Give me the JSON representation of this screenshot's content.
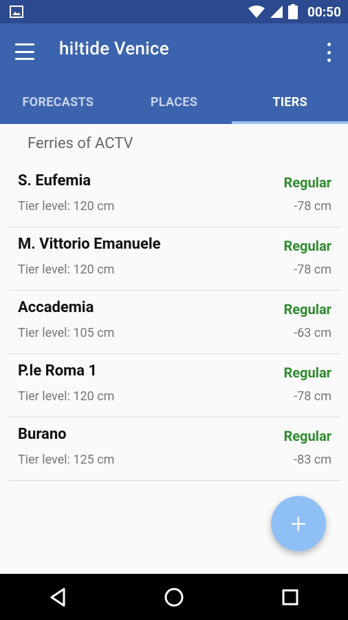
{
  "status_bar": {
    "time": "00:50",
    "icons": [
      "image-icon",
      "wifi-icon",
      "cell-signal-icon",
      "battery-icon"
    ]
  },
  "app_bar": {
    "title": "hi!tide Venice",
    "menu_icon": "hamburger-menu-icon",
    "overflow_icon": "more-vertical-icon"
  },
  "tabs": [
    {
      "label": "FORECASTS",
      "active": false
    },
    {
      "label": "PLACES",
      "active": false
    },
    {
      "label": "TIERS",
      "active": true
    }
  ],
  "section": {
    "title": "Ferries of ACTV"
  },
  "items": [
    {
      "name": "S. Eufemia",
      "status": "Regular",
      "tier": "Tier level: 120 cm",
      "diff": "-78 cm"
    },
    {
      "name": "M. Vittorio Emanuele",
      "status": "Regular",
      "tier": "Tier level: 120 cm",
      "diff": "-78 cm"
    },
    {
      "name": "Accademia",
      "status": "Regular",
      "tier": "Tier level: 105 cm",
      "diff": "-63 cm"
    },
    {
      "name": "P.le Roma 1",
      "status": "Regular",
      "tier": "Tier level: 120 cm",
      "diff": "-78 cm"
    },
    {
      "name": "Burano",
      "status": "Regular",
      "tier": "Tier level: 125 cm",
      "diff": "-83 cm"
    }
  ],
  "fab": {
    "icon": "plus-icon",
    "glyph": "+"
  },
  "colors": {
    "status_bar": "#2b4a8f",
    "app_bar": "#3c63ad",
    "tab_indicator": "#9fc0f2",
    "regular_status": "#2e8b2e",
    "fab": "#8fc0f5"
  },
  "nav_bar": {
    "buttons": [
      "back-icon",
      "home-icon",
      "recents-icon"
    ]
  }
}
